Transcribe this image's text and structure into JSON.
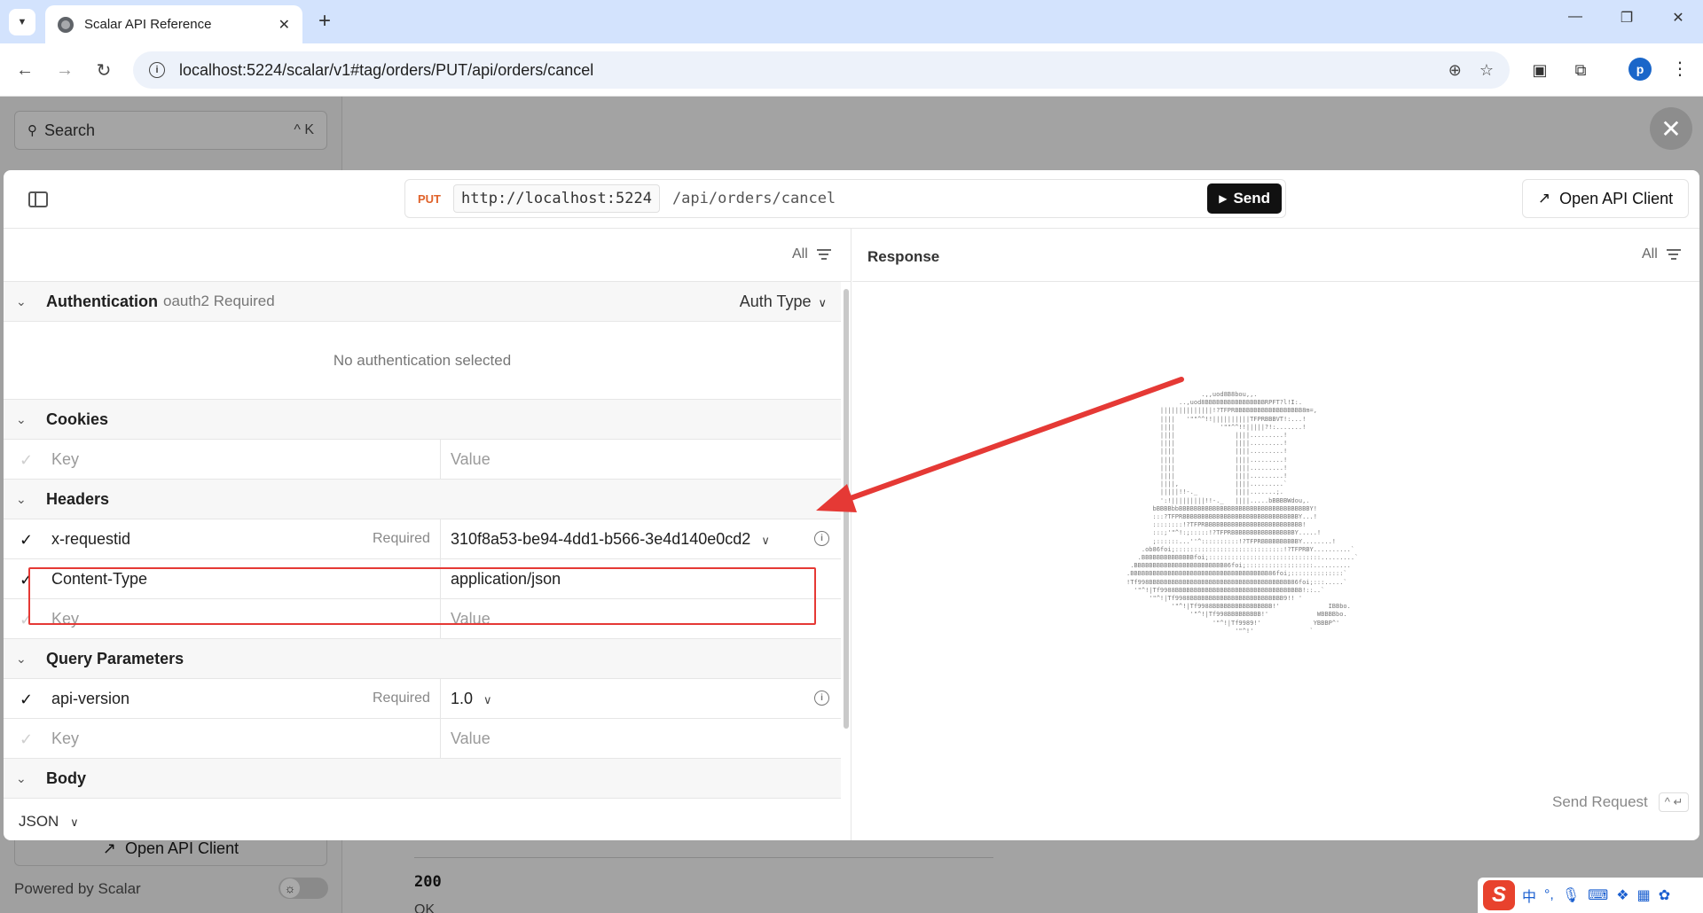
{
  "browser": {
    "tab_title": "Scalar API Reference",
    "url": "localhost:5224/scalar/v1#tag/orders/PUT/api/orders/cancel",
    "profile_initial": "p"
  },
  "background_page": {
    "search_label": "Search",
    "search_shortcut": "^ K",
    "open_api_client": "Open API Client",
    "powered_by": "Powered by Scalar",
    "status_code": "200",
    "status_text": "OK"
  },
  "request_bar": {
    "method": "PUT",
    "server": "http://localhost:5224",
    "path": "/api/orders/cancel",
    "send_label": "Send",
    "open_api_client_label": "Open API Client"
  },
  "request_panel": {
    "filter_label": "All",
    "authentication": {
      "title": "Authentication",
      "subtitle": "oauth2 Required",
      "auth_type_label": "Auth Type",
      "empty_message": "No authentication selected"
    },
    "cookies": {
      "title": "Cookies",
      "key_placeholder": "Key",
      "value_placeholder": "Value"
    },
    "headers": {
      "title": "Headers",
      "rows": [
        {
          "key": "x-requestid",
          "required": "Required",
          "value": "310f8a53-be94-4dd1-b566-3e4d140e0cd2"
        },
        {
          "key": "Content-Type",
          "required": "",
          "value": "application/json"
        }
      ],
      "key_placeholder": "Key",
      "value_placeholder": "Value"
    },
    "query_parameters": {
      "title": "Query Parameters",
      "rows": [
        {
          "key": "api-version",
          "required": "Required",
          "value": "1.0"
        }
      ],
      "key_placeholder": "Key",
      "value_placeholder": "Value"
    },
    "body": {
      "title": "Body",
      "content_type": "JSON"
    }
  },
  "response_panel": {
    "title": "Response",
    "filter_label": "All",
    "send_request_label": "Send Request",
    "send_request_shortcut": "^ ↵"
  },
  "colors": {
    "method_put": "#e0622a",
    "annotation_red": "#e53935",
    "send_button": "#111111",
    "ime_logo": "#e8422d"
  },
  "ime": {
    "logo": "S",
    "lang": "中"
  }
}
